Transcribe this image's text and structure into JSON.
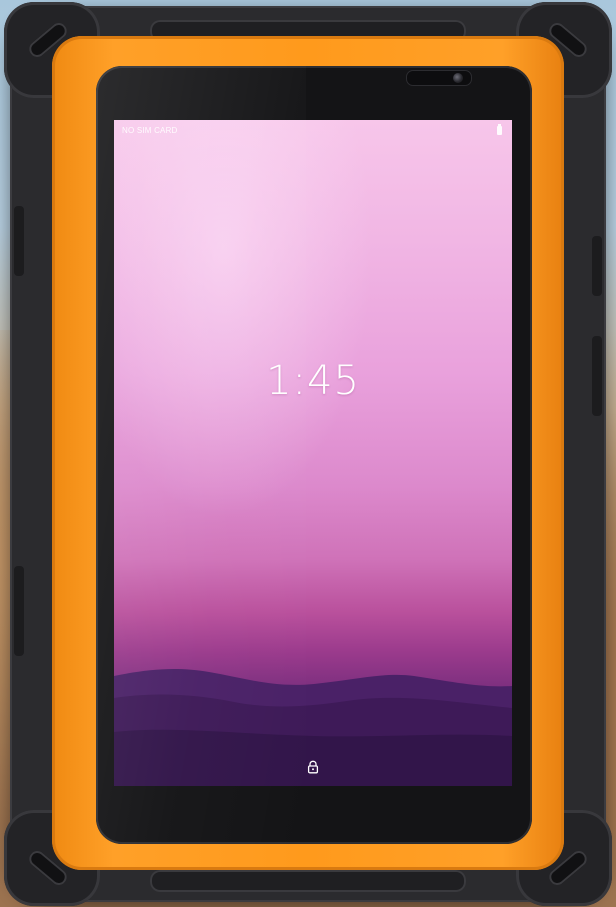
{
  "status_bar": {
    "carrier_text": "NO SIM CARD",
    "battery_icon": "battery-icon"
  },
  "lock_screen": {
    "time": "1:45",
    "unlock_icon": "lock-icon"
  },
  "device": {
    "frame_color": "#ff9a1c",
    "body_color": "#2b2b2e"
  },
  "wallpaper": {
    "top_color": "#f7c6ea",
    "bottom_color": "#4d1f5e",
    "hills_color": "#3e1a58"
  }
}
